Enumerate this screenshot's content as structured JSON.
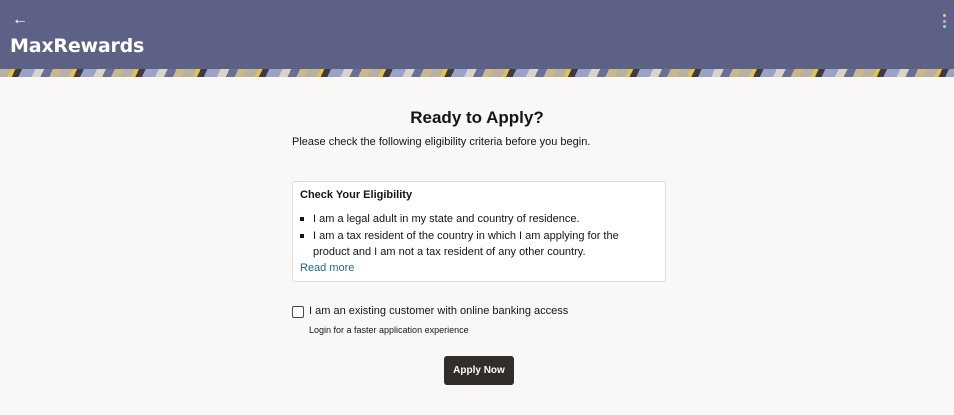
{
  "header": {
    "app_title": "MaxRewards",
    "back_icon": "←",
    "menu_icon": "kebab-menu-icon",
    "menu_dot_colors": [
      "#f5c96a",
      "#e89bd0",
      "#8fd8f0"
    ]
  },
  "colors": {
    "header_bg": "#5d6185",
    "page_bg": "#f9f8f6",
    "link": "#1e6b87",
    "button_bg": "#312d2a"
  },
  "main": {
    "title": "Ready to Apply?",
    "subtitle": "Please check the following eligibility criteria before you begin."
  },
  "eligibility": {
    "title": "Check Your Eligibility",
    "items": [
      "I am a legal adult in my state and country of residence.",
      "I am a tax resident of the country in which I am applying for the product and I am not a tax resident of any other country."
    ],
    "read_more": "Read more"
  },
  "existing_customer": {
    "label": "I am an existing customer with online banking access",
    "hint": "Login for a faster application experience",
    "checked": false
  },
  "apply_button": "Apply Now"
}
